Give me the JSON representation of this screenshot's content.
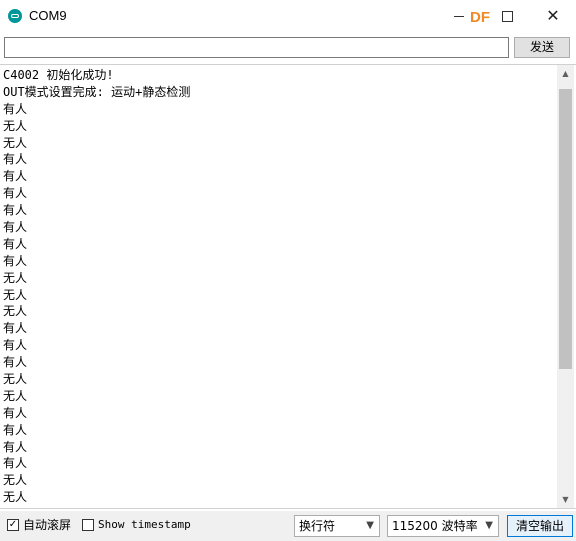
{
  "window": {
    "title": "COM9",
    "watermark": "DF"
  },
  "send": {
    "input_value": "",
    "button_label": "发送"
  },
  "output_lines": [
    "C4002 初始化成功!",
    "OUT模式设置完成: 运动+静态检测",
    "有人",
    "无人",
    "无人",
    "有人",
    "有人",
    "有人",
    "有人",
    "有人",
    "有人",
    "有人",
    "无人",
    "无人",
    "无人",
    "有人",
    "有人",
    "有人",
    "无人",
    "无人",
    "有人",
    "有人",
    "有人",
    "有人",
    "无人",
    "无人"
  ],
  "footer": {
    "autoscroll_label": "自动滚屏",
    "autoscroll_checked": true,
    "timestamp_label": "Show timestamp",
    "timestamp_checked": false,
    "line_ending": "换行符",
    "baud_rate": "115200 波特率",
    "clear_label": "清空输出"
  },
  "icons": {
    "app": "arduino-logo-icon",
    "minimize": "minimize-icon",
    "maximize": "maximize-icon",
    "close": "close-icon"
  }
}
